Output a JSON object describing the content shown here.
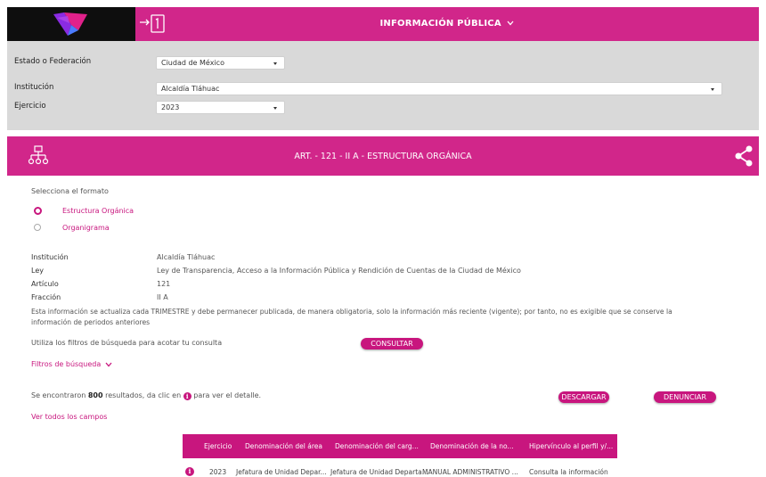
{
  "header": {
    "title": "INFORMACIÓN PÚBLICA"
  },
  "filters": {
    "estado_label": "Estado o Federación",
    "estado_value": "Ciudad de México",
    "institucion_label": "Institución",
    "institucion_value": "Alcaldía Tláhuac",
    "ejercicio_label": "Ejercicio",
    "ejercicio_value": "2023"
  },
  "article": {
    "title": "ART. - 121 - II A - ESTRUCTURA ORGÁNICA"
  },
  "format": {
    "prompt": "Selecciona el formato",
    "option1": "Estructura Orgánica",
    "option2": "Organigrama",
    "selected": "Estructura Orgánica"
  },
  "details": {
    "institucion_label": "Institución",
    "institucion_value": "Alcaldía Tláhuac",
    "ley_label": "Ley",
    "ley_value": "Ley de Transparencia, Acceso a la Información Pública y Rendición de Cuentas de la Ciudad de México",
    "articulo_label": "Artículo",
    "articulo_value": "121",
    "fraccion_label": "Fracción",
    "fraccion_value": "II A",
    "note_line1": "Esta información se actualiza cada TRIMESTRE y debe permanecer publicada, de manera obligatoria, solo la información más reciente (vigente); por tanto, no es exigible que se conserve la",
    "note_line2": "información de periodos anteriores"
  },
  "search": {
    "hint": "Utiliza los filtros de búsqueda para acotar tu consulta",
    "consultar": "CONSULTAR",
    "filtros": "Filtros de búsqueda"
  },
  "results": {
    "prefix": "Se encontraron ",
    "count": "800",
    "middle": " resultados, da clic en ",
    "suffix": " para ver el detalle.",
    "descargar": "DESCARGAR",
    "denunciar": "DENUNCIAR",
    "ver_todos": "Ver todos los campos"
  },
  "table": {
    "headers": [
      "Ejercicio",
      "Denominación del área",
      "Denominación del carg...",
      "Denominación de la no...",
      "Hipervínculo al perfil y/..."
    ],
    "rows": [
      {
        "ejercicio": "2023",
        "area": "Jefatura de Unidad Depar...",
        "cargo": "Jefatura de Unidad Departa...",
        "norma": "MANUAL ADMINISTRATIVO ...",
        "link": "Consulta la información"
      }
    ]
  },
  "colors": {
    "brand_pink": "#d1268a",
    "panel_gray": "#d9d9d9"
  }
}
